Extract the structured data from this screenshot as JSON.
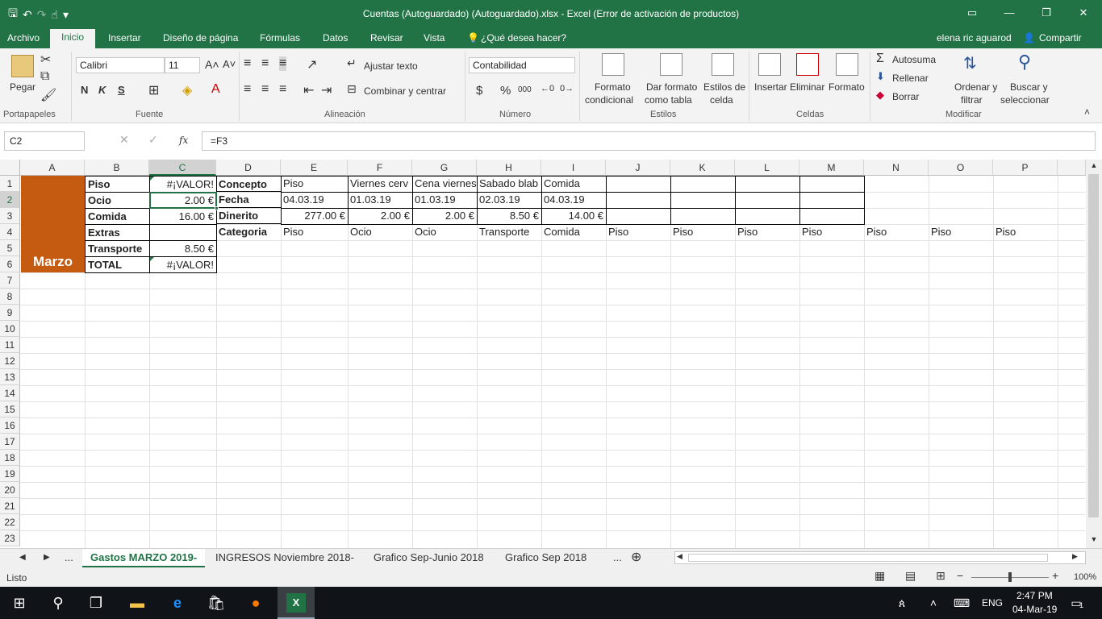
{
  "window": {
    "title": "Cuentas (Autoguardado) (Autoguardado).xlsx - Excel (Error de activación de productos)",
    "qat_undo": "↶",
    "qat_redo": "↷",
    "qat_more": "▾"
  },
  "menu": {
    "tabs": [
      "Archivo",
      "Inicio",
      "Insertar",
      "Diseño de página",
      "Fórmulas",
      "Datos",
      "Revisar",
      "Vista"
    ],
    "tell_me": "¿Qué desea hacer?",
    "user": "elena ric aguarod",
    "share": "Compartir"
  },
  "ribbon": {
    "clipboard": {
      "label": "Portapapeles",
      "paste": "Pegar"
    },
    "font": {
      "label": "Fuente",
      "name": "Calibri",
      "size": "11",
      "bold": "N",
      "italic": "K",
      "underline": "S"
    },
    "alignment": {
      "label": "Alineación",
      "wrap": "Ajustar texto",
      "merge": "Combinar y centrar"
    },
    "number": {
      "label": "Número",
      "format": "Contabilidad",
      "currency": "$",
      "percent": "%",
      "thousands": "000"
    },
    "styles": {
      "label": "Estilos",
      "cond1": "Formato",
      "cond2": "condicional",
      "table1": "Dar formato",
      "table2": "como tabla",
      "cell1": "Estilos de",
      "cell2": "celda"
    },
    "cells": {
      "label": "Celdas",
      "insert": "Insertar",
      "delete": "Eliminar",
      "format": "Formato"
    },
    "editing": {
      "label": "Modificar",
      "autosum": "Autosuma",
      "fill": "Rellenar",
      "clear": "Borrar",
      "sort1": "Ordenar y",
      "sort2": "filtrar",
      "find1": "Buscar y",
      "find2": "seleccionar"
    }
  },
  "formula_bar": {
    "name_box": "C2",
    "fx": "fx",
    "formula": "=F3"
  },
  "grid": {
    "columns": [
      "A",
      "B",
      "C",
      "D",
      "E",
      "F",
      "G",
      "H",
      "I",
      "J",
      "K",
      "L",
      "M",
      "N",
      "O",
      "P"
    ],
    "rows": [
      "1",
      "2",
      "3",
      "4",
      "5",
      "6",
      "7",
      "8",
      "9",
      "10",
      "11",
      "12",
      "13",
      "14",
      "15",
      "16",
      "17",
      "18",
      "19",
      "20",
      "21",
      "22",
      "23"
    ],
    "marzo": "Marzo",
    "B": [
      "Piso",
      "Ocio",
      "Comida",
      "Extras",
      "Transporte",
      "TOTAL"
    ],
    "C": [
      "#¡VALOR!",
      "2.00 €",
      "16.00 €",
      "",
      "8.50 €",
      "#¡VALOR!"
    ],
    "D": [
      "Concepto",
      "Fecha",
      "Dinerito",
      "Categoria"
    ],
    "concepto": [
      "Piso",
      "Viernes cerv",
      "Cena viernes",
      "Sabado blab",
      "Comida"
    ],
    "fecha": [
      "04.03.19",
      "01.03.19",
      "01.03.19",
      "02.03.19",
      "04.03.19"
    ],
    "dinerito": [
      "277.00 €",
      "2.00 €",
      "2.00 €",
      "8.50 €",
      "14.00 €"
    ],
    "categoria": [
      "Piso",
      "Ocio",
      "Ocio",
      "Transporte",
      "Comida",
      "Piso",
      "Piso",
      "Piso",
      "Piso",
      "Piso",
      "Piso",
      "Piso"
    ]
  },
  "sheets": {
    "more_left": "...",
    "tabs": [
      "Gastos MARZO 2019-",
      "INGRESOS Noviembre 2018-",
      "Grafico Sep-Junio 2018",
      "Grafico Sep 2018"
    ],
    "more_right": "...",
    "add": "⊕"
  },
  "status": {
    "mode": "Listo",
    "zoom": "100%"
  },
  "taskbar": {
    "lang": "ENG",
    "time": "2:47 PM",
    "date": "04-Mar-19",
    "notif": "1"
  }
}
